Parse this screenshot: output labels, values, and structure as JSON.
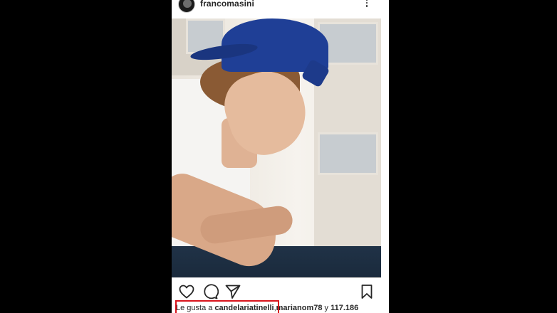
{
  "post": {
    "username": "francomasini",
    "photo_alt": "",
    "likes_prefix": "Le gusta a",
    "likes_user1": "candelariatinelli",
    "likes_sep": ",",
    "likes_user2": "marianom78",
    "likes_conj": "y",
    "likes_count": "117.186"
  },
  "icons": {
    "like": "heart-icon",
    "comment": "comment-icon",
    "share": "send-icon",
    "save": "bookmark-icon",
    "more": "more-vertical-icon"
  },
  "colors": {
    "highlight": "#d8141c",
    "text": "#262626",
    "background": "#000000"
  }
}
